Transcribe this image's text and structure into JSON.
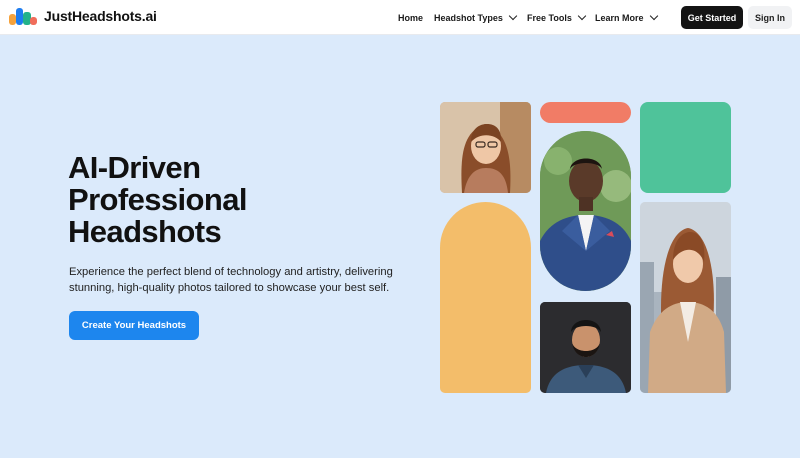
{
  "brand": {
    "name": "JustHeadshots.ai"
  },
  "nav": {
    "items": [
      {
        "label": "Home",
        "has_dropdown": false
      },
      {
        "label": "Headshot Types",
        "has_dropdown": true
      },
      {
        "label": "Free Tools",
        "has_dropdown": true
      },
      {
        "label": "Learn More",
        "has_dropdown": true
      }
    ],
    "get_started_label": "Get Started",
    "sign_in_label": "Sign In"
  },
  "hero": {
    "title_lines": [
      "AI-Driven",
      "Professional",
      "Headshots"
    ],
    "subtitle": "Experience the perfect blend of technology and artistry, delivering stunning, high-quality photos tailored to showcase your best self.",
    "cta_label": "Create Your Headshots"
  },
  "colors": {
    "background": "#dbeafb",
    "primary_button": "#1d86ee",
    "dark_button": "#141414",
    "coral_tile": "#f17c66",
    "green_tile": "#4fc39a",
    "yellow_tile": "#f3bd6a"
  },
  "collage": [
    {
      "kind": "photo",
      "subject": "woman-with-glasses-headshot"
    },
    {
      "kind": "shape",
      "color": "coral"
    },
    {
      "kind": "shape",
      "color": "green"
    },
    {
      "kind": "photo",
      "subject": "man-in-blue-suit-headshot"
    },
    {
      "kind": "shape",
      "color": "yellow"
    },
    {
      "kind": "photo",
      "subject": "woman-in-beige-blazer-headshot"
    },
    {
      "kind": "photo",
      "subject": "bearded-man-headshot"
    }
  ]
}
